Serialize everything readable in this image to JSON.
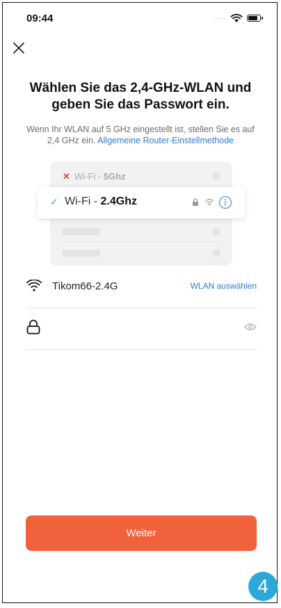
{
  "status_bar": {
    "time": "09:44",
    "dots": "....."
  },
  "header": {
    "title": "Wählen Sie das 2,4-GHz-WLAN und geben Sie das Passwort ein.",
    "subtitle": "Wenn Ihr WLAN auf 5 GHz eingestellt ist, stellen Sie es auf 2,4 GHz ein.",
    "subtitle_link": "Allgemeine Router-Einstellmethode"
  },
  "illustration": {
    "wifi_5ghz_prefix": "Wi-Fi - ",
    "wifi_5ghz_band": "5Ghz",
    "wifi_24ghz_prefix": "Wi-Fi - ",
    "wifi_24ghz_band": "2.4Ghz"
  },
  "network": {
    "ssid": "Tikom66-2.4G",
    "select_label": "WLAN auswählen"
  },
  "password": {
    "value": "",
    "placeholder": ""
  },
  "footer": {
    "next_label": "Weiter",
    "step_number": "4"
  },
  "colors": {
    "accent": "#f0613c",
    "link": "#2e7bd1",
    "success": "#3cb77a",
    "error": "#e0443a",
    "badge": "#2aa8d8"
  }
}
